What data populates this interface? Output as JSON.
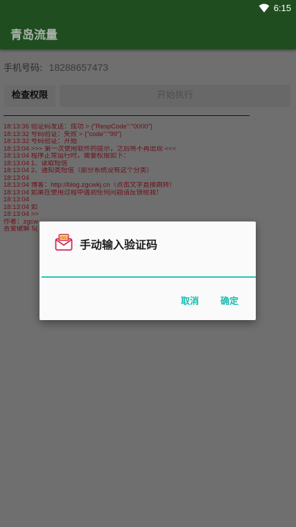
{
  "status_bar": {
    "time": "6:15",
    "wifi_icon": "wifi-icon"
  },
  "app_bar": {
    "title": "青岛流量"
  },
  "phone": {
    "label": "手机号码:",
    "value": "18288657473"
  },
  "buttons": {
    "check_permission": "检查权限",
    "start": "开始执行"
  },
  "log": [
    "18:13:36 验证码发送：成功 > {\"RespCode\":\"0000\"}",
    "18:13:32 号码验证：失败 > {\"code\":\"99\"}",
    "18:13:32 号码验证：开始",
    "18:13:04 >>> 第一次使用软件的提示，之后将不再出现 <<<",
    "18:13:04 程序正常运行时，需要权限如下：",
    "18:13:04 1、读取短信",
    "18:13:04 2、通知类短信（部分系统没有这个分类）",
    "18:13:04",
    "18:13:04 博客：http://blog.zgcwkj.cn（点击文字直接跳转）",
    "18:13:04 如果在使用过程中遇到任何问题请反馈给我！",
    "18:13:04",
    "18:13:04 如",
    "18:13:04 >>",
    "作者：zgcw",
    "吾爱破解 5("
  ],
  "dialog": {
    "title": "手动输入验证码",
    "icon": "sms-code-icon",
    "input_value": "",
    "cancel_label": "取消",
    "ok_label": "确定"
  },
  "colors": {
    "app_bar": "#1f4d1f",
    "accent": "#13bfb2",
    "log_text": "#6b0f18",
    "scrim_background": "#6f6f6f"
  }
}
